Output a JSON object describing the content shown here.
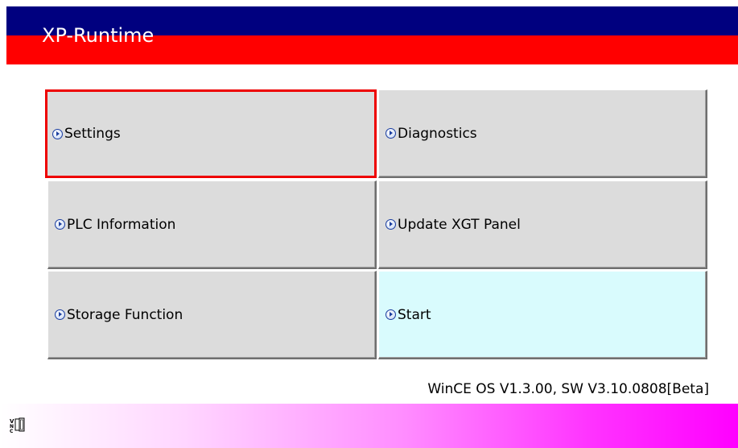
{
  "window": {
    "title": "XP-Runtime"
  },
  "menu": {
    "buttons": [
      {
        "label": "Settings",
        "icon": "circle-arrow-right-icon"
      },
      {
        "label": "Diagnostics",
        "icon": "circle-arrow-right-icon"
      },
      {
        "label": "PLC Information",
        "icon": "circle-arrow-right-icon"
      },
      {
        "label": "Update XGT Panel",
        "icon": "circle-arrow-right-icon"
      },
      {
        "label": "Storage Function",
        "icon": "circle-arrow-right-icon"
      },
      {
        "label": "Start",
        "icon": "circle-arrow-right-icon"
      }
    ],
    "selected": "Settings"
  },
  "footer": {
    "version": "WinCE OS V1.3.00, SW V3.10.0808[Beta]",
    "tray_icon": "vnc-icon"
  },
  "colors": {
    "title_top": "#00007f",
    "title_bottom": "#ff0000",
    "button_bg": "#dcdcdc",
    "start_bg": "#d9fbfd",
    "selected_border": "#ee0000",
    "footer_gradient_end": "#ff00ff"
  }
}
